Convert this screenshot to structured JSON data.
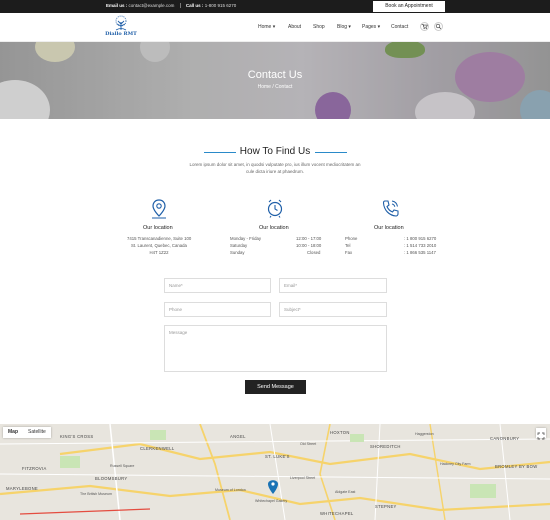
{
  "topbar": {
    "email_label": "Email us :",
    "email_value": "contact@example.com",
    "call_label": "Call us :",
    "call_value": "1-800 915 6270",
    "appointment_button": "Book an Appointment"
  },
  "header": {
    "logo_text": "Diallo RMT",
    "nav": [
      "Home",
      "About",
      "Shop",
      "Blog",
      "Pages",
      "Contact"
    ]
  },
  "hero": {
    "title": "Contact Us",
    "breadcrumb": [
      "Home",
      "Contact"
    ]
  },
  "find": {
    "title": "How To Find Us",
    "intro": "Lorem ipsum dolor sit amet, in quodsi vulputate pro, ius illum vocent mediocritatem an cule dicta iriure at phaedrum.",
    "columns": [
      {
        "icon": "map-marker-icon",
        "heading": "Our location",
        "lines": [
          "7415 Transcanadienne, Suite 100",
          "St. Laurent, Quebec, Canada",
          "H4T 1Z22"
        ]
      },
      {
        "icon": "alarm-clock-icon",
        "heading": "Our location",
        "rows": [
          {
            "label": "Monday - Friday",
            "value": "12:00 - 17:00"
          },
          {
            "label": "Saturday",
            "value": "10:00 - 18:00"
          },
          {
            "label": "Sunday",
            "value": "Closed"
          }
        ]
      },
      {
        "icon": "phone-icon",
        "heading": "Our location",
        "rows": [
          {
            "label": "Phone",
            "value": ": 1 800 915 6270"
          },
          {
            "label": "Tel",
            "value": ": 1 514 733 2010"
          },
          {
            "label": "Fax",
            "value": ": 1 866 535 1147"
          }
        ]
      }
    ]
  },
  "form": {
    "name_placeholder": "Name*",
    "email_placeholder": "Email*",
    "phone_placeholder": "Phone",
    "subject_placeholder": "Subject*",
    "message_placeholder": "Message",
    "send_button": "Send Message"
  },
  "map": {
    "tabs": [
      "Map",
      "Satellite"
    ],
    "labels": [
      "CLERKENWELL",
      "ST. LUKE'S",
      "FITZROVIA",
      "MARYLEBONE",
      "BLOOMSBURY",
      "SHOREDITCH",
      "STEPNEY",
      "WHITECHAPEL",
      "Russell Square",
      "The British Museum",
      "Old Street",
      "Museum of London",
      "Liverpool Street",
      "Aldgate East",
      "Whitechapel Gallery",
      "HOXTON",
      "Haggerston",
      "Hackney City Farm",
      "BROMLEY BY BOW",
      "CANONBURY",
      "ANGEL",
      "KING'S CROSS"
    ]
  }
}
